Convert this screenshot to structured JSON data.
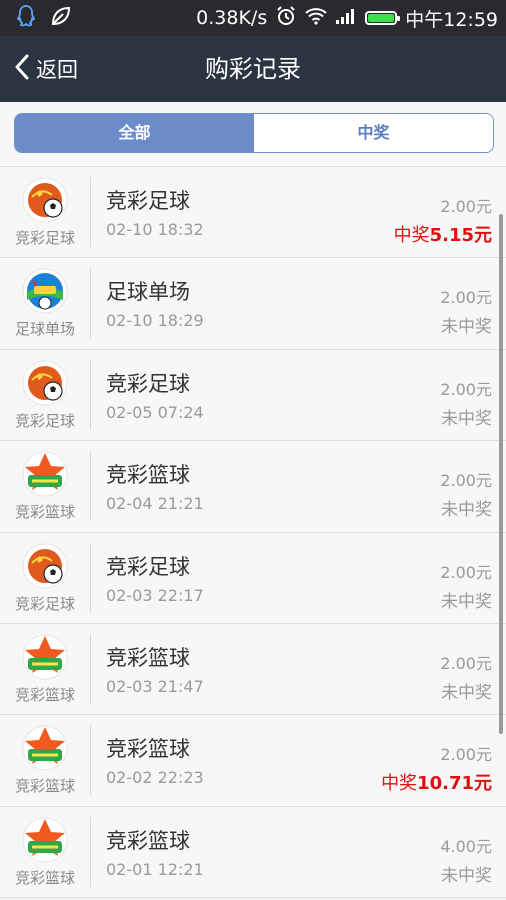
{
  "status_bar": {
    "speed": "0.38K/s",
    "time": "中午12:59",
    "battery_level": 1.0,
    "icons": [
      "qq-icon",
      "leaf-icon",
      "alarm-icon",
      "wifi-icon",
      "signal-icon",
      "battery-icon"
    ]
  },
  "header": {
    "back_label": "返回",
    "title": "购彩记录"
  },
  "tabs": [
    {
      "label": "全部",
      "active": true
    },
    {
      "label": "中奖",
      "active": false
    }
  ],
  "records": [
    {
      "type": "football",
      "logo_label": "竞彩足球",
      "name": "竞彩足球",
      "time": "02-10 18:32",
      "amount": "2.00元",
      "status_prefix": "中奖",
      "prize": "5.15元",
      "win": true
    },
    {
      "type": "single",
      "logo_label": "足球单场",
      "name": "足球单场",
      "time": "02-10 18:29",
      "amount": "2.00元",
      "status": "未中奖",
      "win": false
    },
    {
      "type": "football",
      "logo_label": "竞彩足球",
      "name": "竞彩足球",
      "time": "02-05 07:24",
      "amount": "2.00元",
      "status": "未中奖",
      "win": false
    },
    {
      "type": "basketball",
      "logo_label": "竞彩篮球",
      "name": "竞彩篮球",
      "time": "02-04 21:21",
      "amount": "2.00元",
      "status": "未中奖",
      "win": false
    },
    {
      "type": "football",
      "logo_label": "竞彩足球",
      "name": "竞彩足球",
      "time": "02-03 22:17",
      "amount": "2.00元",
      "status": "未中奖",
      "win": false
    },
    {
      "type": "basketball",
      "logo_label": "竞彩篮球",
      "name": "竞彩篮球",
      "time": "02-03 21:47",
      "amount": "2.00元",
      "status": "未中奖",
      "win": false
    },
    {
      "type": "basketball",
      "logo_label": "竞彩篮球",
      "name": "竞彩篮球",
      "time": "02-02 22:23",
      "amount": "2.00元",
      "status_prefix": "中奖",
      "prize": "10.71元",
      "win": true
    },
    {
      "type": "basketball",
      "logo_label": "竞彩篮球",
      "name": "竞彩篮球",
      "time": "02-01 12:21",
      "amount": "4.00元",
      "status": "未中奖",
      "win": false
    }
  ],
  "colors": {
    "appbar": "#2b3441",
    "tab_active": "#6b8cc9",
    "win_red": "#e01010"
  }
}
